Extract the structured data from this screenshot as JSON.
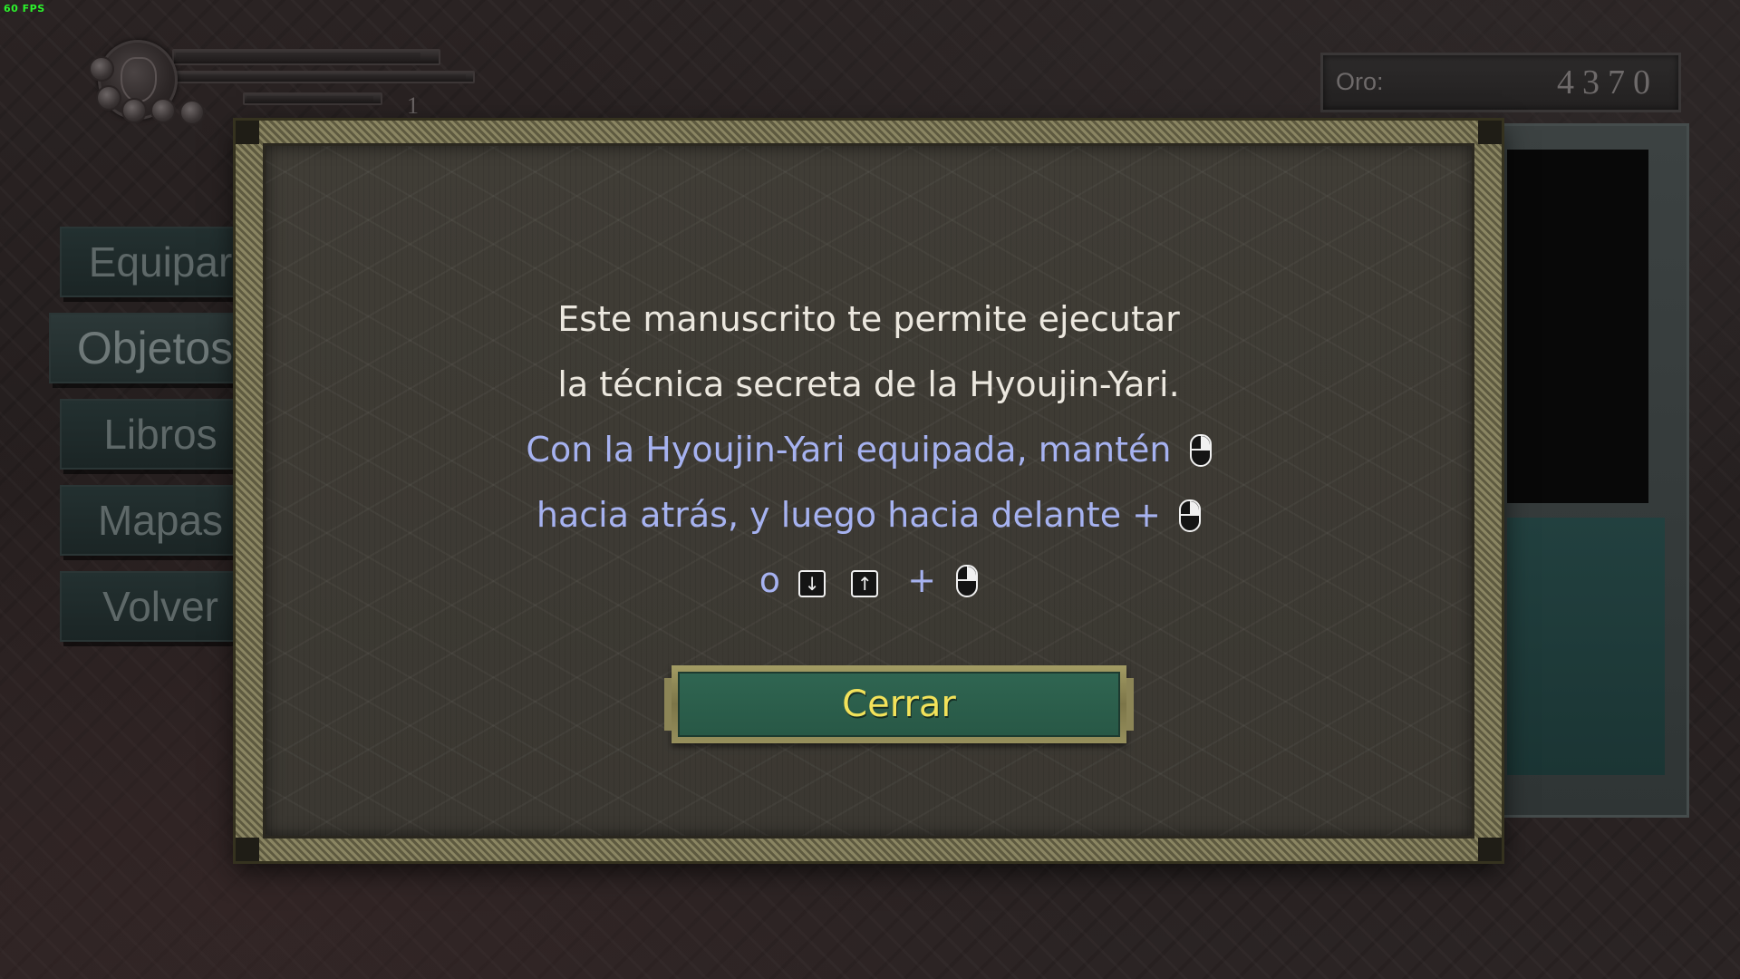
{
  "overlay": {
    "fps": "60 FPS"
  },
  "hud": {
    "level": "1"
  },
  "gold": {
    "label": "Oro:",
    "value": "4370"
  },
  "menu": {
    "items": [
      {
        "label": "Equipar",
        "active": false
      },
      {
        "label": "Objetos",
        "active": true
      },
      {
        "label": "Libros",
        "active": false
      },
      {
        "label": "Mapas",
        "active": false
      },
      {
        "label": "Volver",
        "active": false
      }
    ]
  },
  "dialog": {
    "line1": "Este manuscrito te permite ejecutar",
    "line2": "la técnica secreta de la Hyoujin-Yari.",
    "line3": "Con la Hyoujin-Yari equipada, mantén",
    "line4": "hacia atrás, y luego hacia delante +",
    "line5_prefix": "o",
    "plus": "+",
    "key_down": "↓",
    "key_up": "↑",
    "icons": {
      "mouse": "mouse-right-button-icon",
      "key_down": "arrow-down-key-icon",
      "key_up": "arrow-up-key-icon"
    },
    "close_label": "Cerrar"
  },
  "colors": {
    "instruction_text": "#a6b2f0",
    "body_text": "#ece8df",
    "button_fill": "#2f6551",
    "button_text": "#f2e25a",
    "fps_text": "#2cf32c"
  }
}
